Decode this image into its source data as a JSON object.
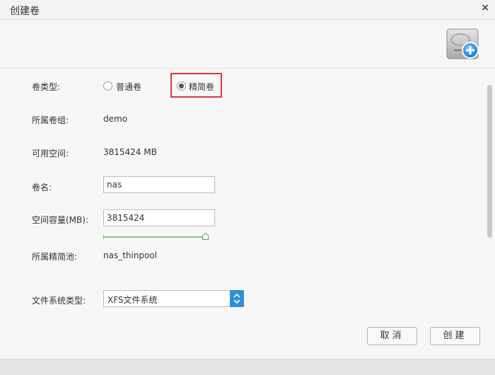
{
  "window": {
    "title": "创建卷",
    "close_glyph": "×"
  },
  "header": {
    "icon": "disk-add-icon"
  },
  "form": {
    "volume_type": {
      "label": "卷类型:",
      "options": [
        {
          "label": "普通卷",
          "checked": false
        },
        {
          "label": "精简卷",
          "checked": true
        }
      ]
    },
    "volume_group": {
      "label": "所属卷组:",
      "value": "demo"
    },
    "available_space": {
      "label": "可用空间:",
      "value": "3815424 MB"
    },
    "volume_name": {
      "label": "卷名:",
      "value": "nas"
    },
    "capacity": {
      "label": "空间容量(MB):",
      "value": "3815424",
      "slider_fraction": 1.0
    },
    "thin_pool": {
      "label": "所属精简池:",
      "value": "nas_thinpool"
    },
    "fs_type": {
      "label": "文件系统类型:",
      "selected": "XFS文件系统"
    }
  },
  "buttons": {
    "cancel": "取消",
    "create": "创建"
  },
  "colors": {
    "highlight": "#e0353a",
    "accent": "#2f8fd6",
    "slider": "#87c97a"
  }
}
